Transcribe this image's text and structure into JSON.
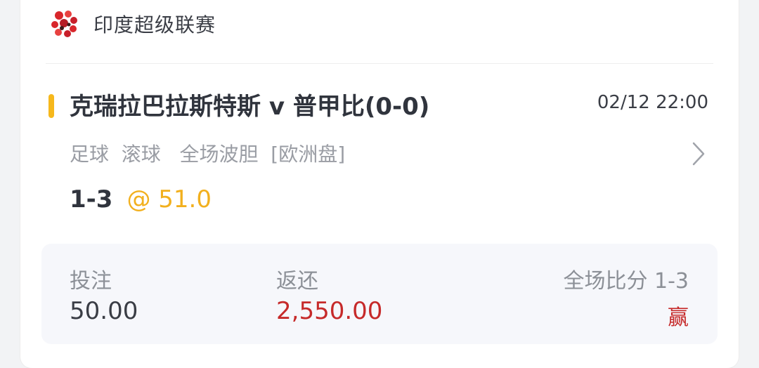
{
  "league": {
    "name": "印度超级联赛",
    "icon": "ball-logo-icon"
  },
  "match": {
    "title": "克瑞拉巴拉斯特斯 v 普甲比(0-0)",
    "datetime": "02/12 22:00",
    "bet_description": "足球  滚球   全场波胆  [欧洲盘]",
    "pick": "1-3",
    "odds": "@ 51.0"
  },
  "summary": {
    "stake_label": "投注",
    "stake_value": "50.00",
    "return_label": "返还",
    "return_value": "2,550.00",
    "full_time_score_label": "全场比分 1-3",
    "result": "赢"
  },
  "colors": {
    "accent": "#f6b81c",
    "odds": "#f2b01e",
    "win": "#c62a2a"
  }
}
